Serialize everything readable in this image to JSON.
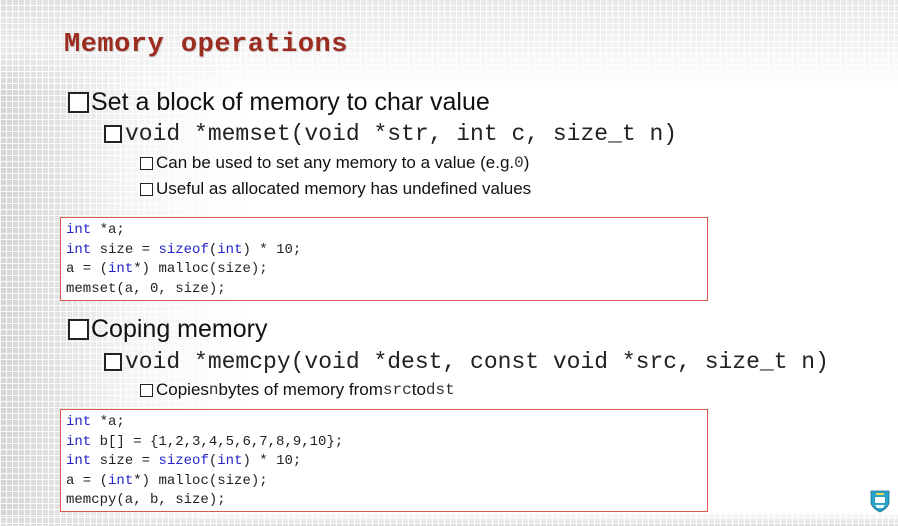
{
  "slide": {
    "title": "Memory operations",
    "section1": {
      "heading": "Set a block of memory to char value",
      "signature": "void *memset(void *str, int c, size_t n)",
      "bullets": [
        {
          "text_before": "Can be used to set any memory to a value (e.g. ",
          "code": "0",
          "text_after": ")"
        },
        {
          "text": "Useful as allocated memory has undefined values"
        }
      ],
      "code": [
        [
          {
            "t": "int",
            "kw": true
          },
          {
            "t": " *a;"
          }
        ],
        [
          {
            "t": "int",
            "kw": true
          },
          {
            "t": " size = "
          },
          {
            "t": "sizeof",
            "kw": true
          },
          {
            "t": "("
          },
          {
            "t": "int",
            "kw": true
          },
          {
            "t": ") * 10;"
          }
        ],
        [
          {
            "t": "a = ("
          },
          {
            "t": "int",
            "kw": true
          },
          {
            "t": "*) malloc(size);"
          }
        ],
        [
          {
            "t": "memset(a, 0, size);"
          }
        ]
      ]
    },
    "section2": {
      "heading": "Coping memory",
      "signature": "void *memcpy(void *dest, const void *src, size_t n)",
      "bullets": [
        {
          "p1": "Copies ",
          "c1": "n",
          "p2": " bytes of memory from ",
          "c2": "src",
          "p3": " to ",
          "c3": "dst"
        }
      ],
      "code": [
        [
          {
            "t": "int",
            "kw": true
          },
          {
            "t": " *a;"
          }
        ],
        [
          {
            "t": "int",
            "kw": true
          },
          {
            "t": " b[] = {1,2,3,4,5,6,7,8,9,10};"
          }
        ],
        [
          {
            "t": "int",
            "kw": true
          },
          {
            "t": " size = "
          },
          {
            "t": "sizeof",
            "kw": true
          },
          {
            "t": "("
          },
          {
            "t": "int",
            "kw": true
          },
          {
            "t": ") * 10;"
          }
        ],
        [
          {
            "t": "a = ("
          },
          {
            "t": "int",
            "kw": true
          },
          {
            "t": "*) malloc(size);"
          }
        ],
        [
          {
            "t": "memcpy(a, b, size);"
          }
        ]
      ]
    },
    "logo": "university-shield-logo"
  },
  "colors": {
    "title": "#9b2d20",
    "keyword": "#2424c8",
    "code_border": "#d9574a"
  }
}
